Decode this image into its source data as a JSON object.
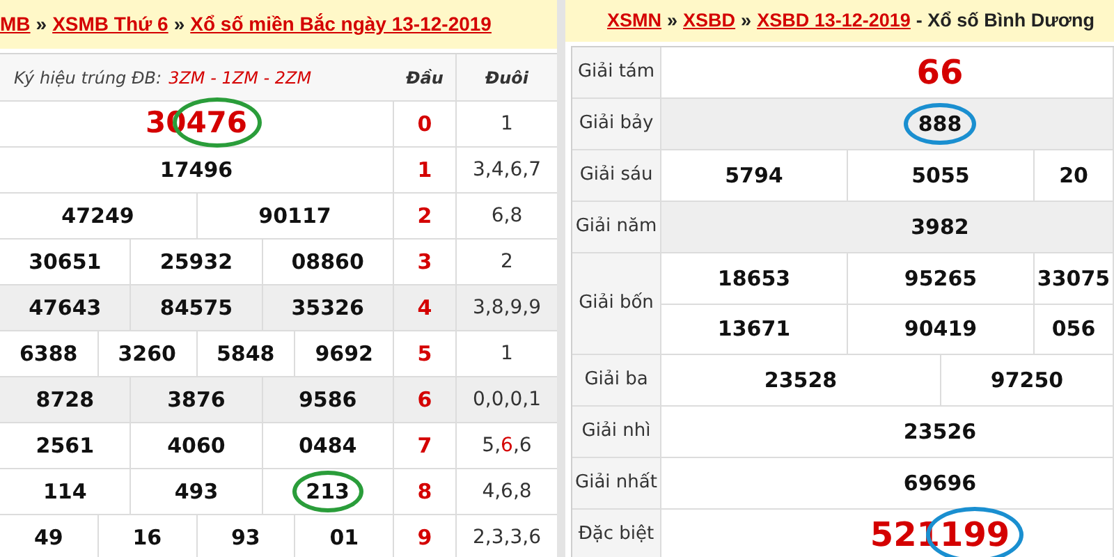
{
  "panels": [
    {
      "kind": "result-grid",
      "breadcrumb": [
        {
          "text": "MB",
          "kind": "link"
        },
        {
          "text": "»",
          "kind": "separator"
        },
        {
          "text": "XSMB Thứ 6",
          "kind": "link"
        },
        {
          "text": "»",
          "kind": "separator"
        },
        {
          "text": "Xổ số miền Bắc ngày 13-12-2019",
          "kind": "link"
        }
      ],
      "table": {
        "symbol_label": "Ký hiệu trúng ĐB:",
        "symbols": "3ZM - 1ZM - 2ZM",
        "head_column": "Đầu",
        "tail_column": "Đuôi",
        "rows": [
          {
            "emphasis": true,
            "shaded": false,
            "numbers": [
              {
                "text": "30",
                "circled": "476",
                "color": "#2a9d3a"
              }
            ],
            "head": "0",
            "tail": [
              {
                "text": "1",
                "hit": false
              }
            ]
          },
          {
            "emphasis": false,
            "shaded": false,
            "numbers": [
              {
                "text": "17496"
              }
            ],
            "head": "1",
            "tail": [
              {
                "text": "3,4,6,7",
                "hit": false
              }
            ]
          },
          {
            "emphasis": false,
            "shaded": false,
            "numbers": [
              {
                "text": "47249"
              },
              {
                "text": "90117"
              }
            ],
            "head": "2",
            "tail": [
              {
                "text": "6,8",
                "hit": false
              }
            ]
          },
          {
            "emphasis": false,
            "shaded": false,
            "numbers": [
              {
                "text": "30651"
              },
              {
                "text": "25932"
              },
              {
                "text": "08860"
              }
            ],
            "head": "3",
            "tail": [
              {
                "text": "2",
                "hit": false
              }
            ]
          },
          {
            "emphasis": false,
            "shaded": true,
            "numbers": [
              {
                "text": "47643"
              },
              {
                "text": "84575"
              },
              {
                "text": "35326"
              }
            ],
            "head": "4",
            "tail": [
              {
                "text": "3,8,9,9",
                "hit": false
              }
            ]
          },
          {
            "emphasis": false,
            "shaded": false,
            "numbers": [
              {
                "text": "6388"
              },
              {
                "text": "3260"
              },
              {
                "text": "5848"
              },
              {
                "text": "9692"
              }
            ],
            "head": "5",
            "tail": [
              {
                "text": "1",
                "hit": false
              }
            ]
          },
          {
            "emphasis": false,
            "shaded": true,
            "numbers": [
              {
                "text": "8728"
              },
              {
                "text": "3876"
              },
              {
                "text": "9586"
              }
            ],
            "head": "6",
            "tail": [
              {
                "text": "0,0,0,1",
                "hit": false
              }
            ]
          },
          {
            "emphasis": false,
            "shaded": false,
            "numbers": [
              {
                "text": "2561"
              },
              {
                "text": "4060"
              },
              {
                "text": "0484"
              }
            ],
            "head": "7",
            "tail": [
              {
                "text": "5,",
                "hit": false
              },
              {
                "text": "6",
                "hit": true
              },
              {
                "text": ",6",
                "hit": false
              }
            ]
          },
          {
            "emphasis": false,
            "shaded": false,
            "numbers": [
              {
                "text": "114"
              },
              {
                "text": "493"
              },
              {
                "circled": "213",
                "color": "#2a9d3a"
              }
            ],
            "head": "8",
            "tail": [
              {
                "text": "4,6,8",
                "hit": false
              }
            ]
          },
          {
            "emphasis": false,
            "shaded": false,
            "numbers": [
              {
                "text": "49"
              },
              {
                "text": "16"
              },
              {
                "text": "93"
              },
              {
                "text": "01"
              }
            ],
            "head": "9",
            "tail": [
              {
                "text": "2,3,3,6",
                "hit": false
              }
            ]
          }
        ]
      }
    },
    {
      "kind": "prize-list",
      "breadcrumb": [
        {
          "text": "XSMN",
          "kind": "link"
        },
        {
          "text": "»",
          "kind": "separator"
        },
        {
          "text": "XSBD",
          "kind": "link"
        },
        {
          "text": "»",
          "kind": "separator"
        },
        {
          "text": "XSBD 13-12-2019",
          "kind": "link"
        },
        {
          "text": "- Xổ số Bình Dương",
          "kind": "title"
        }
      ],
      "table": {
        "rows": [
          {
            "label": "Giải tám",
            "emphasis": true,
            "shaded": false,
            "lines": [
              [
                {
                  "text": "66"
                }
              ]
            ]
          },
          {
            "label": "Giải bảy",
            "emphasis": false,
            "shaded": true,
            "lines": [
              [
                {
                  "circled": "888",
                  "color": "#1a8fd0"
                }
              ]
            ]
          },
          {
            "label": "Giải sáu",
            "emphasis": false,
            "shaded": false,
            "lines": [
              [
                {
                  "text": "5794"
                },
                {
                  "text": "5055"
                },
                {
                  "text": "20"
                }
              ]
            ]
          },
          {
            "label": "Giải năm",
            "emphasis": false,
            "shaded": true,
            "lines": [
              [
                {
                  "text": "3982"
                }
              ]
            ]
          },
          {
            "label": "Giải bốn",
            "emphasis": false,
            "shaded": false,
            "lines": [
              [
                {
                  "text": "18653"
                },
                {
                  "text": "95265"
                },
                {
                  "text": "33075"
                }
              ],
              [
                {
                  "text": "13671"
                },
                {
                  "text": "90419"
                },
                {
                  "text": "056"
                }
              ]
            ]
          },
          {
            "label": "Giải ba",
            "emphasis": false,
            "shaded": false,
            "lines": [
              [
                {
                  "text": "23528"
                },
                {
                  "text": "97250"
                }
              ]
            ]
          },
          {
            "label": "Giải nhì",
            "emphasis": false,
            "shaded": false,
            "lines": [
              [
                {
                  "text": "23526"
                }
              ]
            ]
          },
          {
            "label": "Giải nhất",
            "emphasis": false,
            "shaded": false,
            "lines": [
              [
                {
                  "text": "69696"
                }
              ]
            ]
          },
          {
            "label": "Đặc biệt",
            "emphasis": true,
            "shaded": false,
            "lines": [
              [
                {
                  "text": "521",
                  "circled": "199",
                  "color": "#1a8fd0"
                }
              ]
            ]
          }
        ]
      }
    }
  ]
}
